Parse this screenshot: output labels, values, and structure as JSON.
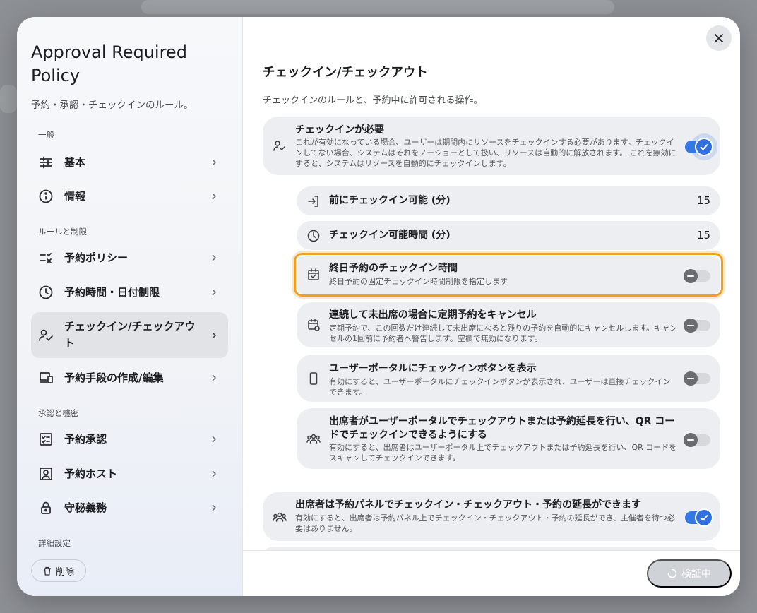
{
  "sidebar": {
    "title": "Approval Required Policy",
    "subtitle": "予約・承認・チェックインのルール。",
    "sections": {
      "general": "一般",
      "rules": "ルールと制限",
      "approval": "承認と機密",
      "advanced": "詳細設定"
    },
    "items": [
      {
        "label": "基本",
        "icon": "sliders-icon"
      },
      {
        "label": "情報",
        "icon": "info-icon"
      },
      {
        "label": "予約ポリシー",
        "icon": "checklist-x-icon"
      },
      {
        "label": "予約時間・日付制限",
        "icon": "clock-icon"
      },
      {
        "label": "チェックイン/チェックアウト",
        "icon": "user-check-icon"
      },
      {
        "label": "予約手段の作成/編集",
        "icon": "devices-icon"
      },
      {
        "label": "予約承認",
        "icon": "approval-list-icon"
      },
      {
        "label": "予約ホスト",
        "icon": "host-card-icon"
      },
      {
        "label": "守秘義務",
        "icon": "lock-icon"
      }
    ],
    "delete_label": "削除"
  },
  "main": {
    "title": "チェックイン/チェックアウト",
    "description": "チェックインのルールと、予約中に許可される操作。",
    "checkin_required": {
      "title": "チェックインが必要",
      "desc": "これが有効になっている場合、ユーザーは期間内にリソースをチェックインする必要があります。チェックインしてない場合、システムはそれをノーショーとして扱い、リソースは自動的に解放されます。 これを無効にすると、システムはリソースを自動的にチェックインします。",
      "enabled": true
    },
    "before_checkin": {
      "title": "前にチェックイン可能 (分)",
      "value": "15"
    },
    "checkin_window": {
      "title": "チェックイン可能時間 (分)",
      "value": "15"
    },
    "allday_checkin": {
      "title": "終日予約のチェックイン時間",
      "desc": "終日予約の固定チェックイン時間制限を指定します",
      "enabled": false
    },
    "cancel_recurring": {
      "title": "連続して未出席の場合に定期予約をキャンセル",
      "desc": "定期予約で、この回数だけ連続して未出席になると残りの予約を自動的にキャンセルします。キャンセルの1回前に予約者へ警告します。空欄で無効になります。",
      "enabled": false
    },
    "portal_button": {
      "title": "ユーザーポータルにチェックインボタンを表示",
      "desc": "有効にすると、ユーザーポータルにチェックインボタンが表示され、ユーザーは直接チェックインできます。",
      "enabled": false
    },
    "attendee_portal": {
      "title": "出席者がユーザーポータルでチェックアウトまたは予約延長を行い、QR コードでチェックインできるようにする",
      "desc": "有効にすると、出席者はユーザーポータル上でチェックアウトまたは予約延長を行い、QR コードをスキャンしてチェックインできます。",
      "enabled": false
    },
    "attendee_panel": {
      "title": "出席者は予約パネルでチェックイン・チェックアウト・予約の延長ができます",
      "desc": "有効にすると、出席者は予約パネル上でチェックイン・チェックアウト・予約の延長ができ、主催者を待つ必要はありません。",
      "enabled": true
    }
  },
  "footer": {
    "verify_label": "検証中"
  },
  "colors": {
    "accent": "#3378e6",
    "focus": "#f0a020"
  }
}
